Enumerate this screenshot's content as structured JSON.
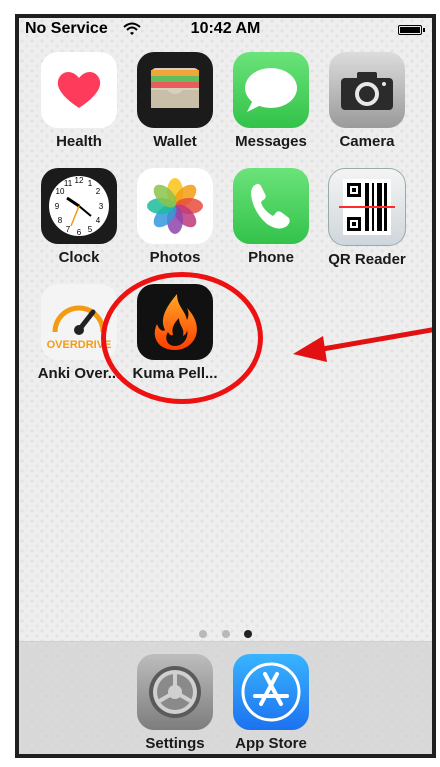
{
  "status_bar": {
    "carrier": "No Service",
    "time": "10:42 AM"
  },
  "apps": [
    {
      "name": "Health",
      "icon": "health-icon"
    },
    {
      "name": "Wallet",
      "icon": "wallet-icon"
    },
    {
      "name": "Messages",
      "icon": "messages-icon"
    },
    {
      "name": "Camera",
      "icon": "camera-icon"
    },
    {
      "name": "Clock",
      "icon": "clock-icon"
    },
    {
      "name": "Photos",
      "icon": "photos-icon"
    },
    {
      "name": "Phone",
      "icon": "phone-icon"
    },
    {
      "name": "QR Reader",
      "icon": "qr-reader-icon"
    },
    {
      "name": "Anki Over...",
      "icon": "anki-overdrive-icon",
      "logo_text": "OVERDRIVE"
    },
    {
      "name": "Kuma Pell...",
      "icon": "kuma-pellets-icon"
    }
  ],
  "page_dots": {
    "count": 3,
    "active": 3
  },
  "dock": [
    {
      "name": "Settings",
      "icon": "settings-icon"
    },
    {
      "name": "App Store",
      "icon": "app-store-icon"
    }
  ],
  "colors": {
    "annotation": "#e11111",
    "health_heart": "#ff3b5c",
    "messages_green": "#4cd964",
    "phone_green": "#4cd964",
    "app_store_blue": "#1c8ef6",
    "anki_orange": "#f39c12",
    "kuma_flame": "#ff6a00"
  }
}
